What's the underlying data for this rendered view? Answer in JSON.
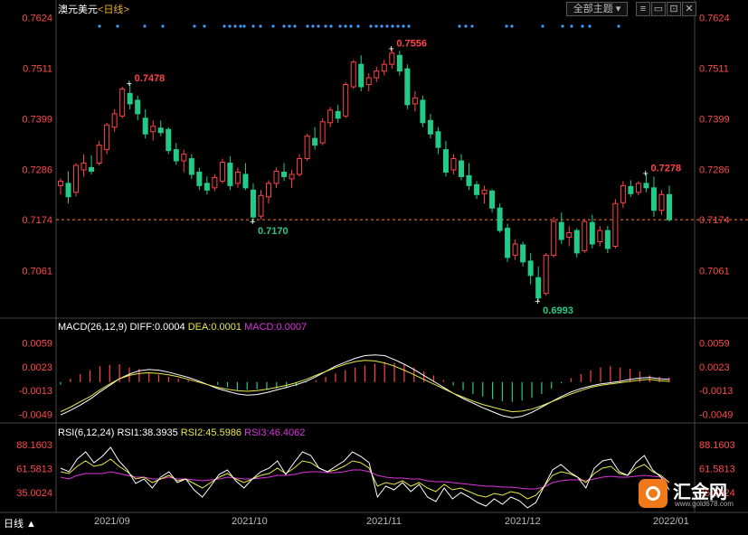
{
  "window": {
    "symbol": "澳元美元",
    "period_label": "日线",
    "theme_button": "全部主题",
    "period_menu": "日线 ▲"
  },
  "legend": {
    "macd_title": "MACD(26,12,9)",
    "diff": "DIFF:0.0004",
    "dea": "DEA:0.0001",
    "macd": "MACD:0.0007",
    "rsi_title": "RSI(6,12,24)",
    "rsi1": "RSI1:38.3935",
    "rsi2": "RSI2:45.5986",
    "rsi3": "RSI3:46.4062"
  },
  "colors": {
    "up": "#ff4444",
    "down": "#22cc88",
    "diff": "#ffffff",
    "dea": "#e8e84a",
    "rsi3": "#dd33dd",
    "price_label_up": "#ff4444",
    "price_label_down": "#22cc88"
  },
  "watermark": {
    "brand": "汇金网",
    "url": "www.gold678.com"
  },
  "chart_data": [
    {
      "type": "candlestick",
      "price_ticks": [
        "0.7624",
        "0.7511",
        "0.7399",
        "0.7286",
        "0.7174",
        "0.7061"
      ],
      "ylim": [
        0.6955,
        0.7635
      ],
      "current_price_line": 0.7174,
      "annotations": [
        {
          "text": "0.7478",
          "value": 0.7478,
          "kind": "high"
        },
        {
          "text": "0.7556",
          "value": 0.7556,
          "kind": "high"
        },
        {
          "text": "0.7170",
          "value": 0.717,
          "kind": "low"
        },
        {
          "text": "0.6993",
          "value": 0.6993,
          "kind": "low"
        },
        {
          "text": "0.7278",
          "value": 0.7278,
          "kind": "high"
        }
      ],
      "x_labels": [
        "2021/09",
        "2021/10",
        "2021/11",
        "2021/12",
        "2022/01"
      ],
      "candles": [
        [
          0.725,
          0.7266,
          0.723,
          0.726
        ],
        [
          0.7255,
          0.7282,
          0.721,
          0.7225
        ],
        [
          0.7235,
          0.73,
          0.7226,
          0.7295
        ],
        [
          0.7285,
          0.732,
          0.727,
          0.73
        ],
        [
          0.729,
          0.7318,
          0.7275,
          0.7282
        ],
        [
          0.73,
          0.735,
          0.7295,
          0.734
        ],
        [
          0.733,
          0.739,
          0.732,
          0.7385
        ],
        [
          0.738,
          0.742,
          0.737,
          0.741
        ],
        [
          0.7405,
          0.747,
          0.74,
          0.7465
        ],
        [
          0.7455,
          0.7478,
          0.742,
          0.7432
        ],
        [
          0.744,
          0.745,
          0.7395,
          0.741
        ],
        [
          0.74,
          0.742,
          0.7355,
          0.7365
        ],
        [
          0.737,
          0.7395,
          0.735,
          0.7382
        ],
        [
          0.7378,
          0.7395,
          0.736,
          0.7368
        ],
        [
          0.7375,
          0.738,
          0.732,
          0.7328
        ],
        [
          0.733,
          0.7345,
          0.7296,
          0.7305
        ],
        [
          0.7305,
          0.733,
          0.728,
          0.732
        ],
        [
          0.731,
          0.732,
          0.7265,
          0.7275
        ],
        [
          0.728,
          0.729,
          0.724,
          0.725
        ],
        [
          0.7255,
          0.727,
          0.723,
          0.724
        ],
        [
          0.7245,
          0.7275,
          0.7238,
          0.7268
        ],
        [
          0.726,
          0.731,
          0.7255,
          0.7302
        ],
        [
          0.73,
          0.7315,
          0.724,
          0.725
        ],
        [
          0.7255,
          0.729,
          0.7245,
          0.728
        ],
        [
          0.7275,
          0.73,
          0.724,
          0.7245
        ],
        [
          0.724,
          0.7255,
          0.717,
          0.718
        ],
        [
          0.7182,
          0.724,
          0.7175,
          0.7228
        ],
        [
          0.7225,
          0.7262,
          0.721,
          0.7255
        ],
        [
          0.7255,
          0.729,
          0.7245,
          0.7282
        ],
        [
          0.728,
          0.73,
          0.726,
          0.727
        ],
        [
          0.7265,
          0.7285,
          0.7245,
          0.7275
        ],
        [
          0.7275,
          0.732,
          0.727,
          0.731
        ],
        [
          0.731,
          0.7365,
          0.7305,
          0.736
        ],
        [
          0.7355,
          0.738,
          0.733,
          0.734
        ],
        [
          0.7345,
          0.74,
          0.734,
          0.7392
        ],
        [
          0.739,
          0.7425,
          0.738,
          0.7418
        ],
        [
          0.7415,
          0.743,
          0.739,
          0.74
        ],
        [
          0.7405,
          0.748,
          0.74,
          0.7475
        ],
        [
          0.747,
          0.753,
          0.7465,
          0.7525
        ],
        [
          0.752,
          0.754,
          0.746,
          0.747
        ],
        [
          0.7475,
          0.75,
          0.746,
          0.749
        ],
        [
          0.749,
          0.7515,
          0.748,
          0.7505
        ],
        [
          0.7505,
          0.753,
          0.7495,
          0.752
        ],
        [
          0.752,
          0.7556,
          0.751,
          0.7545
        ],
        [
          0.754,
          0.755,
          0.7495,
          0.7505
        ],
        [
          0.751,
          0.752,
          0.742,
          0.743
        ],
        [
          0.7432,
          0.746,
          0.7415,
          0.7445
        ],
        [
          0.744,
          0.745,
          0.738,
          0.739
        ],
        [
          0.7395,
          0.741,
          0.7355,
          0.7365
        ],
        [
          0.737,
          0.738,
          0.732,
          0.7335
        ],
        [
          0.733,
          0.735,
          0.727,
          0.728
        ],
        [
          0.7285,
          0.732,
          0.7275,
          0.731
        ],
        [
          0.7305,
          0.732,
          0.7262,
          0.727
        ],
        [
          0.7272,
          0.73,
          0.724,
          0.725
        ],
        [
          0.7252,
          0.726,
          0.722,
          0.723
        ],
        [
          0.7232,
          0.725,
          0.721,
          0.724
        ],
        [
          0.7238,
          0.7242,
          0.719,
          0.72
        ],
        [
          0.72,
          0.721,
          0.7145,
          0.715
        ],
        [
          0.7155,
          0.7165,
          0.708,
          0.709
        ],
        [
          0.7095,
          0.713,
          0.7085,
          0.712
        ],
        [
          0.7118,
          0.7125,
          0.707,
          0.708
        ],
        [
          0.7082,
          0.71,
          0.703,
          0.705
        ],
        [
          0.7045,
          0.707,
          0.6993,
          0.7
        ],
        [
          0.701,
          0.71,
          0.7005,
          0.7095
        ],
        [
          0.7095,
          0.718,
          0.709,
          0.717
        ],
        [
          0.7168,
          0.719,
          0.712,
          0.713
        ],
        [
          0.7135,
          0.716,
          0.7115,
          0.7145
        ],
        [
          0.715,
          0.7155,
          0.709,
          0.71
        ],
        [
          0.7105,
          0.7175,
          0.71,
          0.717
        ],
        [
          0.7168,
          0.7185,
          0.711,
          0.712
        ],
        [
          0.7125,
          0.716,
          0.7115,
          0.715
        ],
        [
          0.715,
          0.716,
          0.71,
          0.711
        ],
        [
          0.7115,
          0.722,
          0.711,
          0.721
        ],
        [
          0.7212,
          0.726,
          0.72,
          0.725
        ],
        [
          0.7248,
          0.7262,
          0.7225,
          0.7232
        ],
        [
          0.7235,
          0.726,
          0.7228,
          0.7255
        ],
        [
          0.7255,
          0.7278,
          0.7235,
          0.7245
        ],
        [
          0.7245,
          0.727,
          0.718,
          0.7195
        ],
        [
          0.7195,
          0.724,
          0.7185,
          0.723
        ],
        [
          0.723,
          0.725,
          0.717,
          0.7174
        ]
      ]
    },
    {
      "type": "macd",
      "ticks": [
        "0.0059",
        "0.0023",
        "-0.0013",
        "-0.0049"
      ],
      "ylim": [
        -0.0062,
        0.0075
      ],
      "diff": [
        -0.005,
        -0.0043,
        -0.0035,
        -0.0026,
        -0.0015,
        -0.0005,
        0.0005,
        0.0012,
        0.0017,
        0.0019,
        0.0018,
        0.0015,
        0.0011,
        0.0007,
        0.0002,
        -0.0004,
        -0.001,
        -0.0014,
        -0.0018,
        -0.002,
        -0.0019,
        -0.0016,
        -0.0012,
        -0.0008,
        -0.0004,
        0.0001,
        0.0008,
        0.0016,
        0.0024,
        0.003,
        0.0036,
        0.004,
        0.0041,
        0.004,
        0.0034,
        0.0027,
        0.0019,
        0.001,
        0.0001,
        -0.0008,
        -0.0017,
        -0.0025,
        -0.0032,
        -0.0039,
        -0.0045,
        -0.0051,
        -0.0054,
        -0.0052,
        -0.0046,
        -0.0038,
        -0.003,
        -0.0022,
        -0.0015,
        -0.001,
        -0.0006,
        -0.0003,
        -0.0001,
        0.0001,
        0.0004,
        0.0006,
        0.0007,
        0.0005,
        0.0004
      ],
      "dea": [
        -0.0045,
        -0.0038,
        -0.003,
        -0.0022,
        -0.0012,
        -0.0003,
        0.0005,
        0.001,
        0.0013,
        0.0014,
        0.0013,
        0.0011,
        0.0008,
        0.0004,
        0.0,
        -0.0004,
        -0.0008,
        -0.0011,
        -0.0013,
        -0.0014,
        -0.0013,
        -0.0011,
        -0.0008,
        -0.0005,
        -0.0001,
        0.0004,
        0.001,
        0.0016,
        0.0022,
        0.0027,
        0.0031,
        0.0033,
        0.0032,
        0.0029,
        0.0024,
        0.0018,
        0.0011,
        0.0004,
        -0.0003,
        -0.001,
        -0.0017,
        -0.0023,
        -0.0029,
        -0.0034,
        -0.0038,
        -0.0042,
        -0.0045,
        -0.0044,
        -0.0041,
        -0.0036,
        -0.003,
        -0.0024,
        -0.0018,
        -0.0013,
        -0.0008,
        -0.0005,
        -0.0003,
        -0.0001,
        0.0001,
        0.0003,
        0.0004,
        0.0002,
        0.0001
      ],
      "hist": [
        -0.0004,
        0.0005,
        0.0012,
        0.0018,
        0.0024,
        0.0026,
        0.0027,
        0.0022,
        0.002,
        0.0014,
        0.0011,
        0.0008,
        0.0005,
        0.0003,
        0.0002,
        0.0,
        -0.0004,
        -0.0008,
        -0.0012,
        -0.0012,
        -0.0011,
        -0.0012,
        -0.001,
        -0.0009,
        -0.0006,
        -0.0001,
        0.0003,
        0.0008,
        0.0013,
        0.0018,
        0.0022,
        0.0025,
        0.0028,
        0.003,
        0.0029,
        0.0026,
        0.0022,
        0.0016,
        0.001,
        0.0003,
        -0.0005,
        -0.0012,
        -0.0018,
        -0.0022,
        -0.0026,
        -0.0029,
        -0.003,
        -0.0028,
        -0.0024,
        -0.0018,
        -0.001,
        -0.0002,
        0.0006,
        0.0012,
        0.0018,
        0.0022,
        0.0024,
        0.0022,
        0.002,
        0.0016,
        0.001,
        0.0008,
        0.0007
      ]
    },
    {
      "type": "rsi",
      "ticks": [
        "88.1603",
        "61.5813",
        "35.0024"
      ],
      "ylim": [
        14,
        96
      ],
      "rsi1": [
        62,
        58,
        72,
        80,
        68,
        75,
        85,
        70,
        60,
        45,
        50,
        40,
        52,
        58,
        46,
        50,
        38,
        30,
        42,
        55,
        60,
        48,
        40,
        50,
        58,
        62,
        70,
        55,
        68,
        80,
        76,
        62,
        58,
        64,
        70,
        80,
        75,
        68,
        30,
        42,
        38,
        46,
        36,
        44,
        30,
        25,
        40,
        28,
        35,
        30,
        24,
        20,
        28,
        22,
        30,
        26,
        18,
        24,
        42,
        60,
        66,
        58,
        52,
        40,
        62,
        70,
        72,
        58,
        54,
        68,
        76,
        60,
        52,
        38
      ],
      "rsi2": [
        58,
        56,
        64,
        70,
        64,
        66,
        72,
        64,
        58,
        50,
        52,
        46,
        50,
        54,
        48,
        50,
        45,
        40,
        46,
        52,
        56,
        50,
        46,
        50,
        54,
        56,
        62,
        56,
        62,
        70,
        68,
        62,
        58,
        60,
        64,
        70,
        68,
        62,
        42,
        46,
        44,
        48,
        42,
        46,
        40,
        36,
        44,
        38,
        40,
        36,
        32,
        30,
        34,
        32,
        36,
        34,
        28,
        32,
        42,
        54,
        58,
        56,
        52,
        46,
        56,
        62,
        64,
        56,
        54,
        62,
        66,
        58,
        54,
        46
      ],
      "rsi3": [
        52,
        50,
        54,
        56,
        56,
        56,
        58,
        56,
        54,
        52,
        52,
        50,
        50,
        52,
        50,
        50,
        49,
        48,
        49,
        50,
        52,
        51,
        50,
        50,
        51,
        52,
        54,
        54,
        55,
        57,
        58,
        58,
        57,
        57,
        58,
        60,
        60,
        58,
        54,
        52,
        51,
        51,
        50,
        50,
        48,
        47,
        47,
        46,
        45,
        44,
        43,
        42,
        42,
        41,
        41,
        40,
        39,
        39,
        41,
        46,
        48,
        49,
        49,
        48,
        50,
        52,
        53,
        52,
        52,
        53,
        54,
        53,
        52,
        46
      ]
    }
  ]
}
